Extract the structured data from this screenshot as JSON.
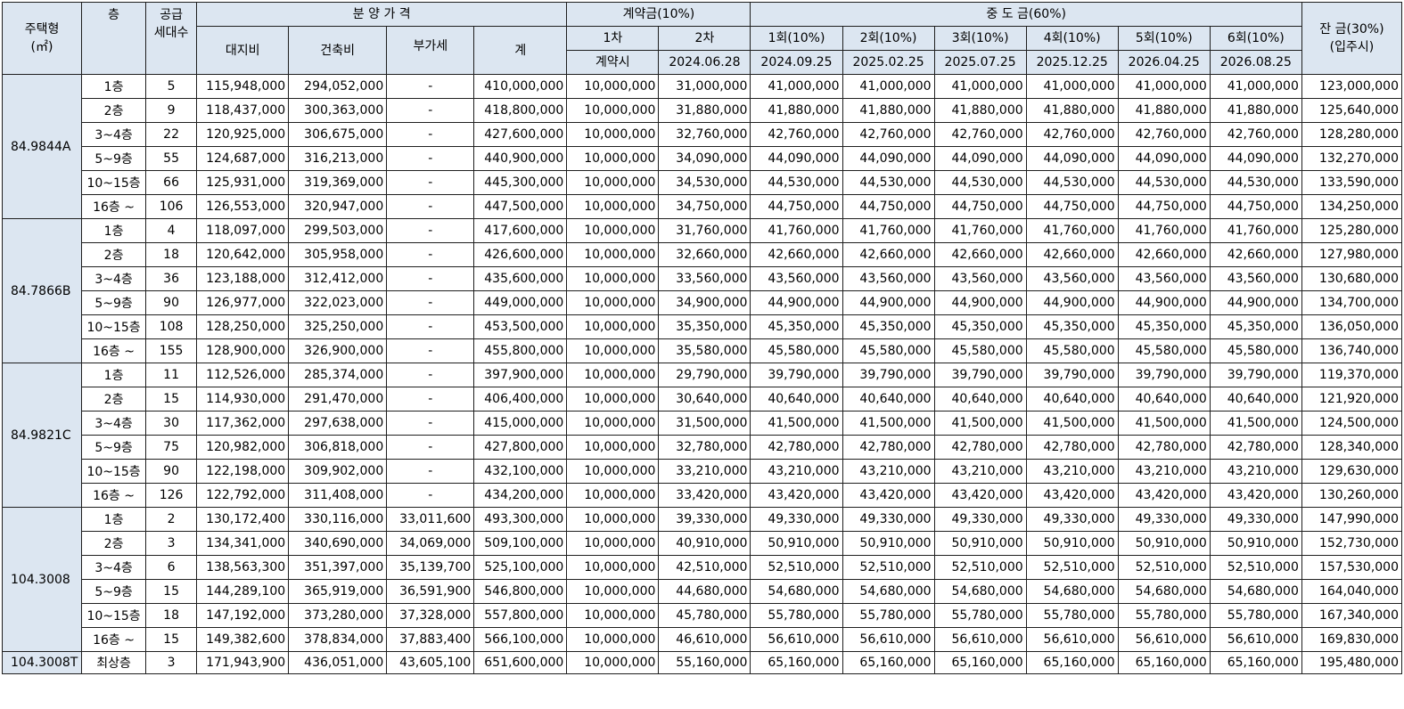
{
  "header": {
    "type": "주택형",
    "type_unit": "(㎡)",
    "floor": "층",
    "supply_1": "공급",
    "supply_2": "세대수",
    "price_group": "분 양 가 격",
    "land": "대지비",
    "building": "건축비",
    "vat": "부가세",
    "total": "계",
    "deposit_group": "계약금(10%)",
    "deposit_1": "1차",
    "deposit_2": "2차",
    "deposit_1_date": "계약시",
    "deposit_2_date": "2024.06.28",
    "mid_group": "중 도 금(60%)",
    "mid": [
      "1회(10%)",
      "2회(10%)",
      "3회(10%)",
      "4회(10%)",
      "5회(10%)",
      "6회(10%)"
    ],
    "mid_dates": [
      "2024.09.25",
      "2025.02.25",
      "2025.07.25",
      "2025.12.25",
      "2026.04.25",
      "2026.08.25"
    ],
    "balance_1": "잔 금(30%)",
    "balance_2": "(입주시)"
  },
  "groups": [
    {
      "type": "84.9844A",
      "rows": [
        {
          "floor": "1층",
          "units": "5",
          "land": "115,948,000",
          "building": "294,052,000",
          "vat": "-",
          "total": "410,000,000",
          "dep1": "10,000,000",
          "dep2": "31,000,000",
          "mid": "41,000,000",
          "balance": "123,000,000"
        },
        {
          "floor": "2층",
          "units": "9",
          "land": "118,437,000",
          "building": "300,363,000",
          "vat": "-",
          "total": "418,800,000",
          "dep1": "10,000,000",
          "dep2": "31,880,000",
          "mid": "41,880,000",
          "balance": "125,640,000"
        },
        {
          "floor": "3~4층",
          "units": "22",
          "land": "120,925,000",
          "building": "306,675,000",
          "vat": "-",
          "total": "427,600,000",
          "dep1": "10,000,000",
          "dep2": "32,760,000",
          "mid": "42,760,000",
          "balance": "128,280,000"
        },
        {
          "floor": "5~9층",
          "units": "55",
          "land": "124,687,000",
          "building": "316,213,000",
          "vat": "-",
          "total": "440,900,000",
          "dep1": "10,000,000",
          "dep2": "34,090,000",
          "mid": "44,090,000",
          "balance": "132,270,000"
        },
        {
          "floor": "10~15층",
          "units": "66",
          "land": "125,931,000",
          "building": "319,369,000",
          "vat": "-",
          "total": "445,300,000",
          "dep1": "10,000,000",
          "dep2": "34,530,000",
          "mid": "44,530,000",
          "balance": "133,590,000"
        },
        {
          "floor": "16층 ~",
          "units": "106",
          "land": "126,553,000",
          "building": "320,947,000",
          "vat": "-",
          "total": "447,500,000",
          "dep1": "10,000,000",
          "dep2": "34,750,000",
          "mid": "44,750,000",
          "balance": "134,250,000"
        }
      ]
    },
    {
      "type": "84.7866B",
      "rows": [
        {
          "floor": "1층",
          "units": "4",
          "land": "118,097,000",
          "building": "299,503,000",
          "vat": "-",
          "total": "417,600,000",
          "dep1": "10,000,000",
          "dep2": "31,760,000",
          "mid": "41,760,000",
          "balance": "125,280,000"
        },
        {
          "floor": "2층",
          "units": "18",
          "land": "120,642,000",
          "building": "305,958,000",
          "vat": "-",
          "total": "426,600,000",
          "dep1": "10,000,000",
          "dep2": "32,660,000",
          "mid": "42,660,000",
          "balance": "127,980,000"
        },
        {
          "floor": "3~4층",
          "units": "36",
          "land": "123,188,000",
          "building": "312,412,000",
          "vat": "-",
          "total": "435,600,000",
          "dep1": "10,000,000",
          "dep2": "33,560,000",
          "mid": "43,560,000",
          "balance": "130,680,000"
        },
        {
          "floor": "5~9층",
          "units": "90",
          "land": "126,977,000",
          "building": "322,023,000",
          "vat": "-",
          "total": "449,000,000",
          "dep1": "10,000,000",
          "dep2": "34,900,000",
          "mid": "44,900,000",
          "balance": "134,700,000"
        },
        {
          "floor": "10~15층",
          "units": "108",
          "land": "128,250,000",
          "building": "325,250,000",
          "vat": "-",
          "total": "453,500,000",
          "dep1": "10,000,000",
          "dep2": "35,350,000",
          "mid": "45,350,000",
          "balance": "136,050,000"
        },
        {
          "floor": "16층 ~",
          "units": "155",
          "land": "128,900,000",
          "building": "326,900,000",
          "vat": "-",
          "total": "455,800,000",
          "dep1": "10,000,000",
          "dep2": "35,580,000",
          "mid": "45,580,000",
          "balance": "136,740,000"
        }
      ]
    },
    {
      "type": "84.9821C",
      "rows": [
        {
          "floor": "1층",
          "units": "11",
          "land": "112,526,000",
          "building": "285,374,000",
          "vat": "-",
          "total": "397,900,000",
          "dep1": "10,000,000",
          "dep2": "29,790,000",
          "mid": "39,790,000",
          "balance": "119,370,000"
        },
        {
          "floor": "2층",
          "units": "15",
          "land": "114,930,000",
          "building": "291,470,000",
          "vat": "-",
          "total": "406,400,000",
          "dep1": "10,000,000",
          "dep2": "30,640,000",
          "mid": "40,640,000",
          "balance": "121,920,000"
        },
        {
          "floor": "3~4층",
          "units": "30",
          "land": "117,362,000",
          "building": "297,638,000",
          "vat": "-",
          "total": "415,000,000",
          "dep1": "10,000,000",
          "dep2": "31,500,000",
          "mid": "41,500,000",
          "balance": "124,500,000"
        },
        {
          "floor": "5~9층",
          "units": "75",
          "land": "120,982,000",
          "building": "306,818,000",
          "vat": "-",
          "total": "427,800,000",
          "dep1": "10,000,000",
          "dep2": "32,780,000",
          "mid": "42,780,000",
          "balance": "128,340,000"
        },
        {
          "floor": "10~15층",
          "units": "90",
          "land": "122,198,000",
          "building": "309,902,000",
          "vat": "-",
          "total": "432,100,000",
          "dep1": "10,000,000",
          "dep2": "33,210,000",
          "mid": "43,210,000",
          "balance": "129,630,000"
        },
        {
          "floor": "16층 ~",
          "units": "126",
          "land": "122,792,000",
          "building": "311,408,000",
          "vat": "-",
          "total": "434,200,000",
          "dep1": "10,000,000",
          "dep2": "33,420,000",
          "mid": "43,420,000",
          "balance": "130,260,000"
        }
      ]
    },
    {
      "type": "104.3008",
      "rows": [
        {
          "floor": "1층",
          "units": "2",
          "land": "130,172,400",
          "building": "330,116,000",
          "vat": "33,011,600",
          "total": "493,300,000",
          "dep1": "10,000,000",
          "dep2": "39,330,000",
          "mid": "49,330,000",
          "balance": "147,990,000"
        },
        {
          "floor": "2층",
          "units": "3",
          "land": "134,341,000",
          "building": "340,690,000",
          "vat": "34,069,000",
          "total": "509,100,000",
          "dep1": "10,000,000",
          "dep2": "40,910,000",
          "mid": "50,910,000",
          "balance": "152,730,000"
        },
        {
          "floor": "3~4층",
          "units": "6",
          "land": "138,563,300",
          "building": "351,397,000",
          "vat": "35,139,700",
          "total": "525,100,000",
          "dep1": "10,000,000",
          "dep2": "42,510,000",
          "mid": "52,510,000",
          "balance": "157,530,000"
        },
        {
          "floor": "5~9층",
          "units": "15",
          "land": "144,289,100",
          "building": "365,919,000",
          "vat": "36,591,900",
          "total": "546,800,000",
          "dep1": "10,000,000",
          "dep2": "44,680,000",
          "mid": "54,680,000",
          "balance": "164,040,000"
        },
        {
          "floor": "10~15층",
          "units": "18",
          "land": "147,192,000",
          "building": "373,280,000",
          "vat": "37,328,000",
          "total": "557,800,000",
          "dep1": "10,000,000",
          "dep2": "45,780,000",
          "mid": "55,780,000",
          "balance": "167,340,000"
        },
        {
          "floor": "16층 ~",
          "units": "15",
          "land": "149,382,600",
          "building": "378,834,000",
          "vat": "37,883,400",
          "total": "566,100,000",
          "dep1": "10,000,000",
          "dep2": "46,610,000",
          "mid": "56,610,000",
          "balance": "169,830,000"
        }
      ]
    },
    {
      "type": "104.3008T",
      "rows": [
        {
          "floor": "최상층",
          "units": "3",
          "land": "171,943,900",
          "building": "436,051,000",
          "vat": "43,605,100",
          "total": "651,600,000",
          "dep1": "10,000,000",
          "dep2": "55,160,000",
          "mid": "65,160,000",
          "balance": "195,480,000"
        }
      ]
    }
  ]
}
